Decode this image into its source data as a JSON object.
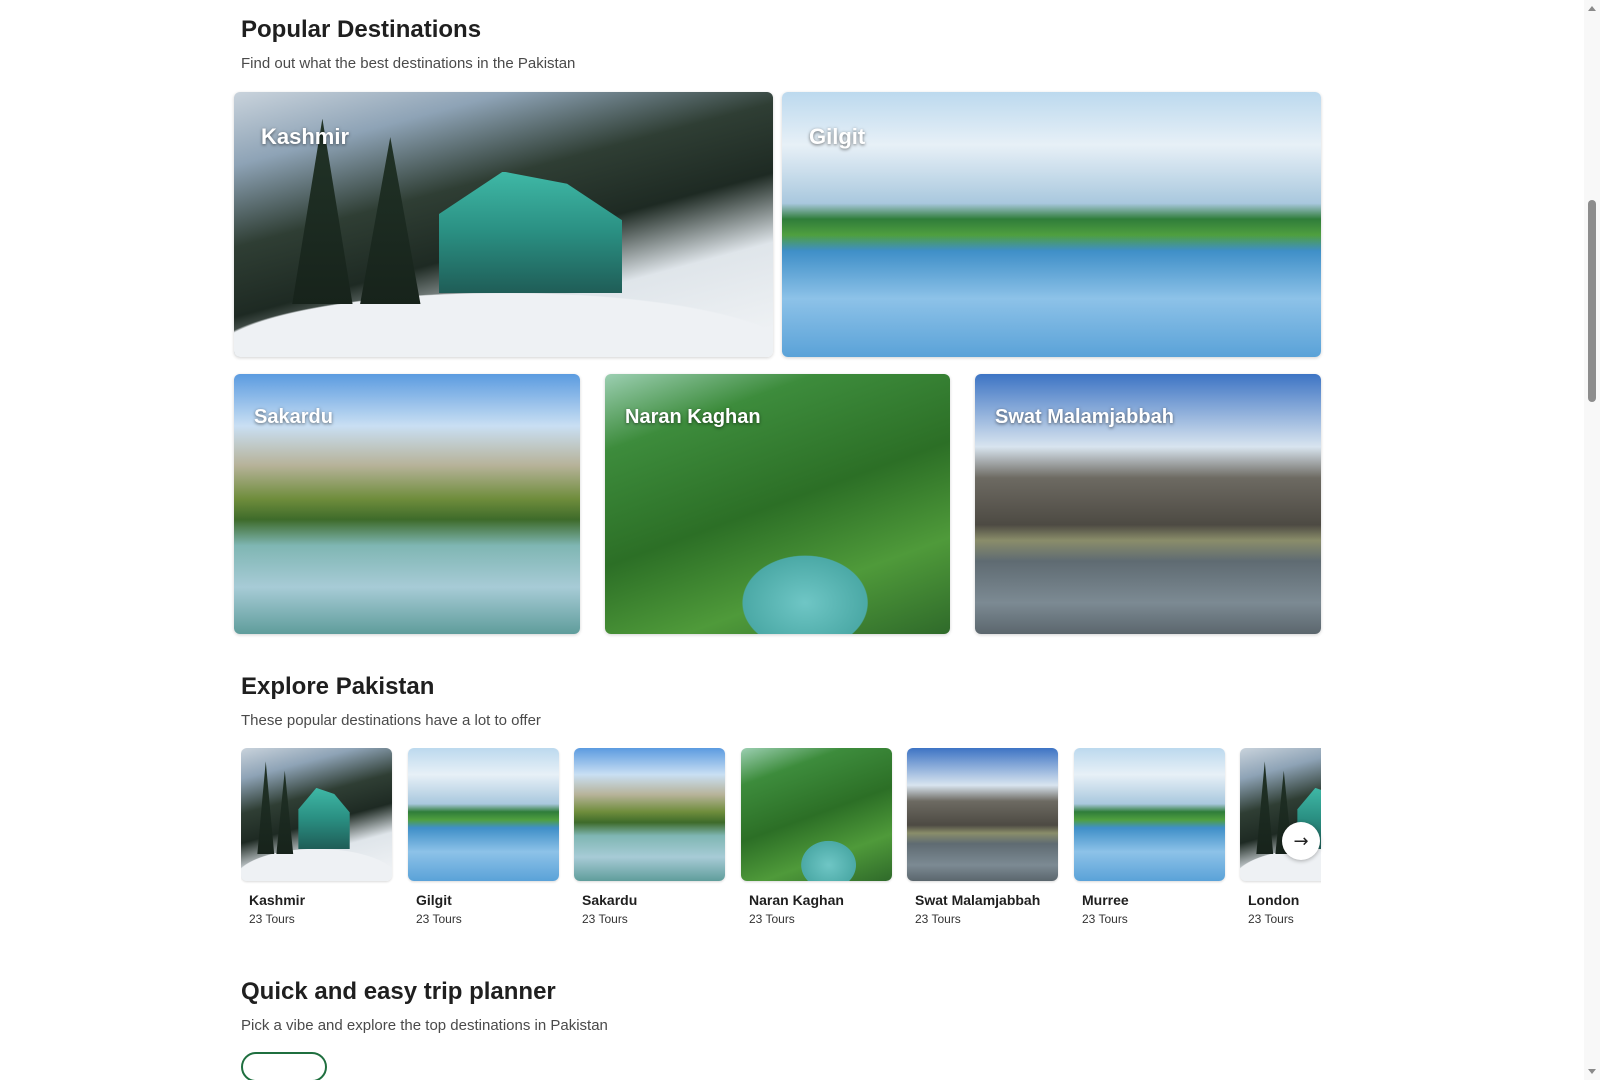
{
  "popular": {
    "title": "Popular Destinations",
    "subtitle": "Find out what the best destinations in the Pakistan",
    "tiles": [
      {
        "label": "Kashmir"
      },
      {
        "label": "Gilgit"
      },
      {
        "label": "Sakardu"
      },
      {
        "label": "Naran Kaghan"
      },
      {
        "label": "Swat Malamjabbah"
      }
    ]
  },
  "explore": {
    "title": "Explore Pakistan",
    "subtitle": "These popular destinations have a lot to offer",
    "cards": [
      {
        "name": "Kashmir",
        "tours": "23 Tours"
      },
      {
        "name": "Gilgit",
        "tours": "23 Tours"
      },
      {
        "name": "Sakardu",
        "tours": "23 Tours"
      },
      {
        "name": "Naran Kaghan",
        "tours": "23 Tours"
      },
      {
        "name": "Swat Malamjabbah",
        "tours": "23 Tours"
      },
      {
        "name": "Murree",
        "tours": "23 Tours"
      },
      {
        "name": "London",
        "tours": "23 Tours"
      }
    ],
    "next_icon": "→"
  },
  "planner": {
    "title": "Quick and easy trip planner",
    "subtitle": "Pick a vibe and explore the top destinations in Pakistan"
  },
  "colors": {
    "pill_border": "#1f6f3f",
    "scroll_thumb": "#8d8d8d"
  }
}
